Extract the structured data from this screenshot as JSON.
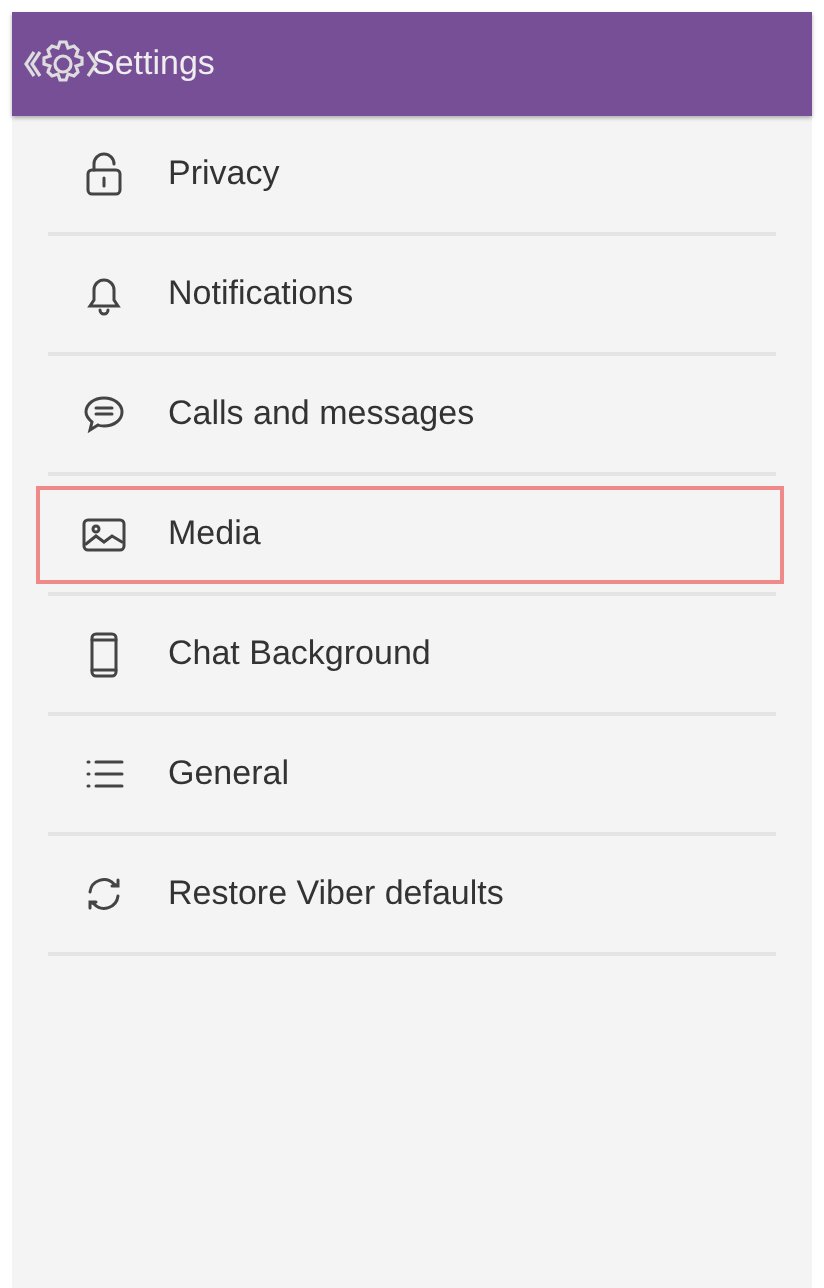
{
  "header": {
    "title": "Settings"
  },
  "items": [
    {
      "kind": "lock",
      "label": "Privacy",
      "selected": false
    },
    {
      "kind": "bell",
      "label": "Notifications",
      "selected": false
    },
    {
      "kind": "chat",
      "label": "Calls and messages",
      "selected": false
    },
    {
      "kind": "image",
      "label": "Media",
      "selected": true
    },
    {
      "kind": "phone",
      "label": "Chat Background",
      "selected": false
    },
    {
      "kind": "list",
      "label": "General",
      "selected": false
    },
    {
      "kind": "restore",
      "label": "Restore Viber defaults",
      "selected": false
    }
  ]
}
